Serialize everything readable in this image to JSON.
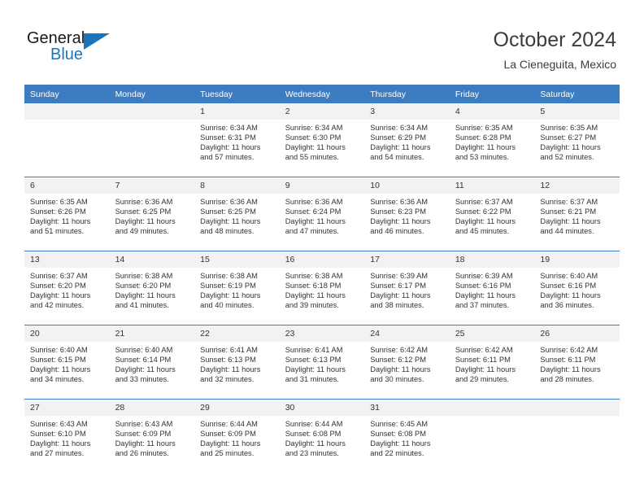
{
  "brand": {
    "word1": "General",
    "word2": "Blue",
    "accent_color": "#1b75bc",
    "triangle_icon": "triangle-icon"
  },
  "header": {
    "title": "October 2024",
    "subtitle": "La Cieneguita, Mexico"
  },
  "calendar": {
    "header_bg": "#3c7cc0",
    "weekdays": [
      "Sunday",
      "Monday",
      "Tuesday",
      "Wednesday",
      "Thursday",
      "Friday",
      "Saturday"
    ],
    "labels": {
      "sunrise": "Sunrise:",
      "sunset": "Sunset:",
      "daylight": "Daylight:"
    },
    "weeks": [
      [
        {
          "day": "",
          "sunrise": "",
          "sunset": "",
          "daylight": ""
        },
        {
          "day": "",
          "sunrise": "",
          "sunset": "",
          "daylight": ""
        },
        {
          "day": "1",
          "sunrise": "Sunrise: 6:34 AM",
          "sunset": "Sunset: 6:31 PM",
          "daylight": "Daylight: 11 hours and 57 minutes."
        },
        {
          "day": "2",
          "sunrise": "Sunrise: 6:34 AM",
          "sunset": "Sunset: 6:30 PM",
          "daylight": "Daylight: 11 hours and 55 minutes."
        },
        {
          "day": "3",
          "sunrise": "Sunrise: 6:34 AM",
          "sunset": "Sunset: 6:29 PM",
          "daylight": "Daylight: 11 hours and 54 minutes."
        },
        {
          "day": "4",
          "sunrise": "Sunrise: 6:35 AM",
          "sunset": "Sunset: 6:28 PM",
          "daylight": "Daylight: 11 hours and 53 minutes."
        },
        {
          "day": "5",
          "sunrise": "Sunrise: 6:35 AM",
          "sunset": "Sunset: 6:27 PM",
          "daylight": "Daylight: 11 hours and 52 minutes."
        }
      ],
      [
        {
          "day": "6",
          "sunrise": "Sunrise: 6:35 AM",
          "sunset": "Sunset: 6:26 PM",
          "daylight": "Daylight: 11 hours and 51 minutes."
        },
        {
          "day": "7",
          "sunrise": "Sunrise: 6:36 AM",
          "sunset": "Sunset: 6:25 PM",
          "daylight": "Daylight: 11 hours and 49 minutes."
        },
        {
          "day": "8",
          "sunrise": "Sunrise: 6:36 AM",
          "sunset": "Sunset: 6:25 PM",
          "daylight": "Daylight: 11 hours and 48 minutes."
        },
        {
          "day": "9",
          "sunrise": "Sunrise: 6:36 AM",
          "sunset": "Sunset: 6:24 PM",
          "daylight": "Daylight: 11 hours and 47 minutes."
        },
        {
          "day": "10",
          "sunrise": "Sunrise: 6:36 AM",
          "sunset": "Sunset: 6:23 PM",
          "daylight": "Daylight: 11 hours and 46 minutes."
        },
        {
          "day": "11",
          "sunrise": "Sunrise: 6:37 AM",
          "sunset": "Sunset: 6:22 PM",
          "daylight": "Daylight: 11 hours and 45 minutes."
        },
        {
          "day": "12",
          "sunrise": "Sunrise: 6:37 AM",
          "sunset": "Sunset: 6:21 PM",
          "daylight": "Daylight: 11 hours and 44 minutes."
        }
      ],
      [
        {
          "day": "13",
          "sunrise": "Sunrise: 6:37 AM",
          "sunset": "Sunset: 6:20 PM",
          "daylight": "Daylight: 11 hours and 42 minutes."
        },
        {
          "day": "14",
          "sunrise": "Sunrise: 6:38 AM",
          "sunset": "Sunset: 6:20 PM",
          "daylight": "Daylight: 11 hours and 41 minutes."
        },
        {
          "day": "15",
          "sunrise": "Sunrise: 6:38 AM",
          "sunset": "Sunset: 6:19 PM",
          "daylight": "Daylight: 11 hours and 40 minutes."
        },
        {
          "day": "16",
          "sunrise": "Sunrise: 6:38 AM",
          "sunset": "Sunset: 6:18 PM",
          "daylight": "Daylight: 11 hours and 39 minutes."
        },
        {
          "day": "17",
          "sunrise": "Sunrise: 6:39 AM",
          "sunset": "Sunset: 6:17 PM",
          "daylight": "Daylight: 11 hours and 38 minutes."
        },
        {
          "day": "18",
          "sunrise": "Sunrise: 6:39 AM",
          "sunset": "Sunset: 6:16 PM",
          "daylight": "Daylight: 11 hours and 37 minutes."
        },
        {
          "day": "19",
          "sunrise": "Sunrise: 6:40 AM",
          "sunset": "Sunset: 6:16 PM",
          "daylight": "Daylight: 11 hours and 36 minutes."
        }
      ],
      [
        {
          "day": "20",
          "sunrise": "Sunrise: 6:40 AM",
          "sunset": "Sunset: 6:15 PM",
          "daylight": "Daylight: 11 hours and 34 minutes."
        },
        {
          "day": "21",
          "sunrise": "Sunrise: 6:40 AM",
          "sunset": "Sunset: 6:14 PM",
          "daylight": "Daylight: 11 hours and 33 minutes."
        },
        {
          "day": "22",
          "sunrise": "Sunrise: 6:41 AM",
          "sunset": "Sunset: 6:13 PM",
          "daylight": "Daylight: 11 hours and 32 minutes."
        },
        {
          "day": "23",
          "sunrise": "Sunrise: 6:41 AM",
          "sunset": "Sunset: 6:13 PM",
          "daylight": "Daylight: 11 hours and 31 minutes."
        },
        {
          "day": "24",
          "sunrise": "Sunrise: 6:42 AM",
          "sunset": "Sunset: 6:12 PM",
          "daylight": "Daylight: 11 hours and 30 minutes."
        },
        {
          "day": "25",
          "sunrise": "Sunrise: 6:42 AM",
          "sunset": "Sunset: 6:11 PM",
          "daylight": "Daylight: 11 hours and 29 minutes."
        },
        {
          "day": "26",
          "sunrise": "Sunrise: 6:42 AM",
          "sunset": "Sunset: 6:11 PM",
          "daylight": "Daylight: 11 hours and 28 minutes."
        }
      ],
      [
        {
          "day": "27",
          "sunrise": "Sunrise: 6:43 AM",
          "sunset": "Sunset: 6:10 PM",
          "daylight": "Daylight: 11 hours and 27 minutes."
        },
        {
          "day": "28",
          "sunrise": "Sunrise: 6:43 AM",
          "sunset": "Sunset: 6:09 PM",
          "daylight": "Daylight: 11 hours and 26 minutes."
        },
        {
          "day": "29",
          "sunrise": "Sunrise: 6:44 AM",
          "sunset": "Sunset: 6:09 PM",
          "daylight": "Daylight: 11 hours and 25 minutes."
        },
        {
          "day": "30",
          "sunrise": "Sunrise: 6:44 AM",
          "sunset": "Sunset: 6:08 PM",
          "daylight": "Daylight: 11 hours and 23 minutes."
        },
        {
          "day": "31",
          "sunrise": "Sunrise: 6:45 AM",
          "sunset": "Sunset: 6:08 PM",
          "daylight": "Daylight: 11 hours and 22 minutes."
        },
        {
          "day": "",
          "sunrise": "",
          "sunset": "",
          "daylight": ""
        },
        {
          "day": "",
          "sunrise": "",
          "sunset": "",
          "daylight": ""
        }
      ]
    ]
  }
}
